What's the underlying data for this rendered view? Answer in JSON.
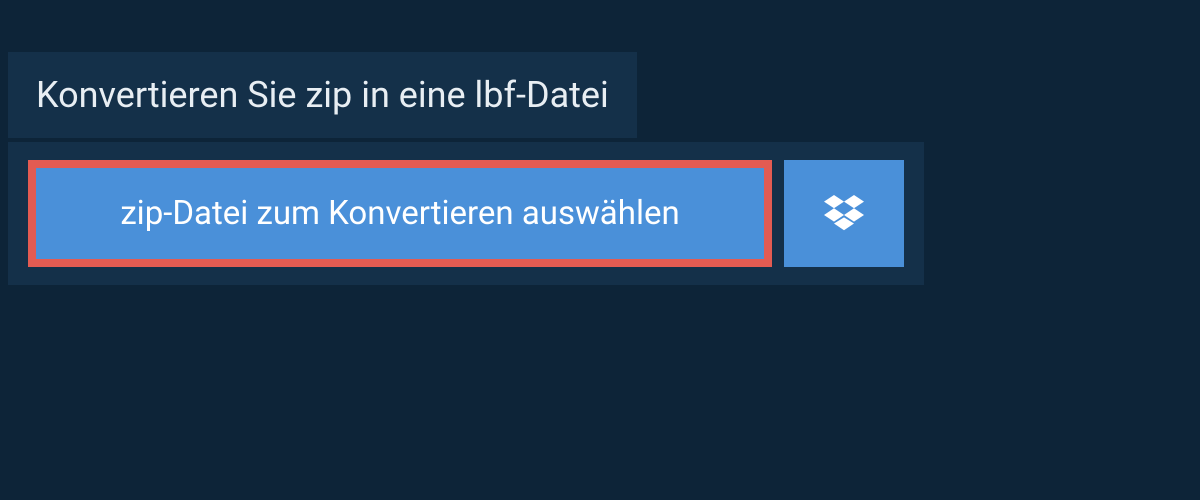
{
  "header": {
    "title": "Konvertieren Sie zip in eine lbf-Datei"
  },
  "upload": {
    "select_file_label": "zip-Datei zum Konvertieren auswählen"
  },
  "colors": {
    "background": "#0d2438",
    "panel": "#143049",
    "button": "#4a90d9",
    "highlight_border": "#e35b52",
    "text_light": "#e8eef3",
    "text_white": "#ffffff"
  }
}
